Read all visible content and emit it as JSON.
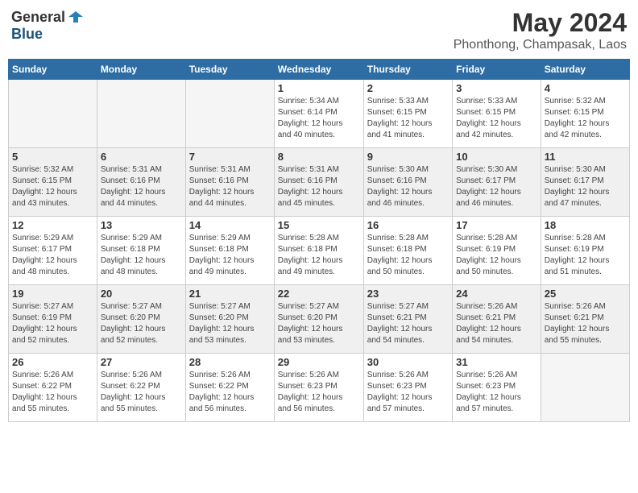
{
  "logo": {
    "general": "General",
    "blue": "Blue"
  },
  "title": {
    "month_year": "May 2024",
    "location": "Phonthong, Champasak, Laos"
  },
  "weekdays": [
    "Sunday",
    "Monday",
    "Tuesday",
    "Wednesday",
    "Thursday",
    "Friday",
    "Saturday"
  ],
  "weeks": [
    [
      {
        "day": "",
        "info": ""
      },
      {
        "day": "",
        "info": ""
      },
      {
        "day": "",
        "info": ""
      },
      {
        "day": "1",
        "info": "Sunrise: 5:34 AM\nSunset: 6:14 PM\nDaylight: 12 hours\nand 40 minutes."
      },
      {
        "day": "2",
        "info": "Sunrise: 5:33 AM\nSunset: 6:15 PM\nDaylight: 12 hours\nand 41 minutes."
      },
      {
        "day": "3",
        "info": "Sunrise: 5:33 AM\nSunset: 6:15 PM\nDaylight: 12 hours\nand 42 minutes."
      },
      {
        "day": "4",
        "info": "Sunrise: 5:32 AM\nSunset: 6:15 PM\nDaylight: 12 hours\nand 42 minutes."
      }
    ],
    [
      {
        "day": "5",
        "info": "Sunrise: 5:32 AM\nSunset: 6:15 PM\nDaylight: 12 hours\nand 43 minutes."
      },
      {
        "day": "6",
        "info": "Sunrise: 5:31 AM\nSunset: 6:16 PM\nDaylight: 12 hours\nand 44 minutes."
      },
      {
        "day": "7",
        "info": "Sunrise: 5:31 AM\nSunset: 6:16 PM\nDaylight: 12 hours\nand 44 minutes."
      },
      {
        "day": "8",
        "info": "Sunrise: 5:31 AM\nSunset: 6:16 PM\nDaylight: 12 hours\nand 45 minutes."
      },
      {
        "day": "9",
        "info": "Sunrise: 5:30 AM\nSunset: 6:16 PM\nDaylight: 12 hours\nand 46 minutes."
      },
      {
        "day": "10",
        "info": "Sunrise: 5:30 AM\nSunset: 6:17 PM\nDaylight: 12 hours\nand 46 minutes."
      },
      {
        "day": "11",
        "info": "Sunrise: 5:30 AM\nSunset: 6:17 PM\nDaylight: 12 hours\nand 47 minutes."
      }
    ],
    [
      {
        "day": "12",
        "info": "Sunrise: 5:29 AM\nSunset: 6:17 PM\nDaylight: 12 hours\nand 48 minutes."
      },
      {
        "day": "13",
        "info": "Sunrise: 5:29 AM\nSunset: 6:18 PM\nDaylight: 12 hours\nand 48 minutes."
      },
      {
        "day": "14",
        "info": "Sunrise: 5:29 AM\nSunset: 6:18 PM\nDaylight: 12 hours\nand 49 minutes."
      },
      {
        "day": "15",
        "info": "Sunrise: 5:28 AM\nSunset: 6:18 PM\nDaylight: 12 hours\nand 49 minutes."
      },
      {
        "day": "16",
        "info": "Sunrise: 5:28 AM\nSunset: 6:18 PM\nDaylight: 12 hours\nand 50 minutes."
      },
      {
        "day": "17",
        "info": "Sunrise: 5:28 AM\nSunset: 6:19 PM\nDaylight: 12 hours\nand 50 minutes."
      },
      {
        "day": "18",
        "info": "Sunrise: 5:28 AM\nSunset: 6:19 PM\nDaylight: 12 hours\nand 51 minutes."
      }
    ],
    [
      {
        "day": "19",
        "info": "Sunrise: 5:27 AM\nSunset: 6:19 PM\nDaylight: 12 hours\nand 52 minutes."
      },
      {
        "day": "20",
        "info": "Sunrise: 5:27 AM\nSunset: 6:20 PM\nDaylight: 12 hours\nand 52 minutes."
      },
      {
        "day": "21",
        "info": "Sunrise: 5:27 AM\nSunset: 6:20 PM\nDaylight: 12 hours\nand 53 minutes."
      },
      {
        "day": "22",
        "info": "Sunrise: 5:27 AM\nSunset: 6:20 PM\nDaylight: 12 hours\nand 53 minutes."
      },
      {
        "day": "23",
        "info": "Sunrise: 5:27 AM\nSunset: 6:21 PM\nDaylight: 12 hours\nand 54 minutes."
      },
      {
        "day": "24",
        "info": "Sunrise: 5:26 AM\nSunset: 6:21 PM\nDaylight: 12 hours\nand 54 minutes."
      },
      {
        "day": "25",
        "info": "Sunrise: 5:26 AM\nSunset: 6:21 PM\nDaylight: 12 hours\nand 55 minutes."
      }
    ],
    [
      {
        "day": "26",
        "info": "Sunrise: 5:26 AM\nSunset: 6:22 PM\nDaylight: 12 hours\nand 55 minutes."
      },
      {
        "day": "27",
        "info": "Sunrise: 5:26 AM\nSunset: 6:22 PM\nDaylight: 12 hours\nand 55 minutes."
      },
      {
        "day": "28",
        "info": "Sunrise: 5:26 AM\nSunset: 6:22 PM\nDaylight: 12 hours\nand 56 minutes."
      },
      {
        "day": "29",
        "info": "Sunrise: 5:26 AM\nSunset: 6:23 PM\nDaylight: 12 hours\nand 56 minutes."
      },
      {
        "day": "30",
        "info": "Sunrise: 5:26 AM\nSunset: 6:23 PM\nDaylight: 12 hours\nand 57 minutes."
      },
      {
        "day": "31",
        "info": "Sunrise: 5:26 AM\nSunset: 6:23 PM\nDaylight: 12 hours\nand 57 minutes."
      },
      {
        "day": "",
        "info": ""
      }
    ]
  ]
}
